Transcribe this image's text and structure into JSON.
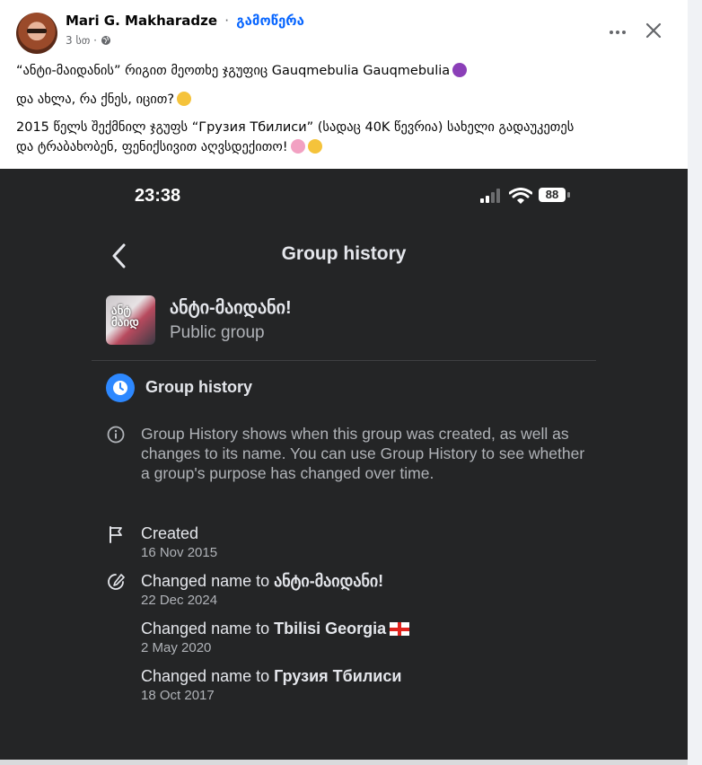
{
  "post": {
    "author": "Mari G. Makharadze",
    "separator": "·",
    "follow_label": "გამოწერა",
    "time": "3 სთ ·",
    "line1": "“ანტი-მაიდანის” რიგით მეოთხე ჯგუფიც Gauqmebulia Gauqmebulia",
    "line2": "და ახლა, რა ქნეს, იცით?",
    "line3a": "2015 წელს შექმნილ ჯგუფს “Грузия Тбилиси” (სადაც 40K წევრია) სახელი გადაუკეთეს",
    "line3b": "და ტრაბახობენ, ფენიქსივით აღვსდექითო!",
    "icons": {
      "more": "more-options-icon",
      "close": "close-icon",
      "audience": "globe-icon"
    }
  },
  "phone": {
    "status_time": "23:38",
    "battery": "88",
    "nav_title": "Group history",
    "group": {
      "thumb_text": "ანტ მაიდ",
      "name": "ანტი-მაიდანი!",
      "type": "Public group"
    },
    "section_title": "Group history",
    "description": "Group History shows when this group was created, as well as changes to its name. You can use Group History to see whether a group's purpose has changed over time.",
    "events": [
      {
        "prefix": "Created",
        "name": "",
        "date": "16 Nov 2015"
      },
      {
        "prefix": "Changed name to ",
        "name": "ანტი-მაიდანი!",
        "date": "22 Dec 2024"
      },
      {
        "prefix": "Changed name to ",
        "name": "Tbilisi Georgia",
        "date": "2 May 2020"
      },
      {
        "prefix": "Changed name to ",
        "name": "Грузия Тбилиси",
        "date": "18 Oct 2017"
      }
    ],
    "colors": {
      "background": "#242526",
      "accent": "#2d88ff"
    }
  }
}
